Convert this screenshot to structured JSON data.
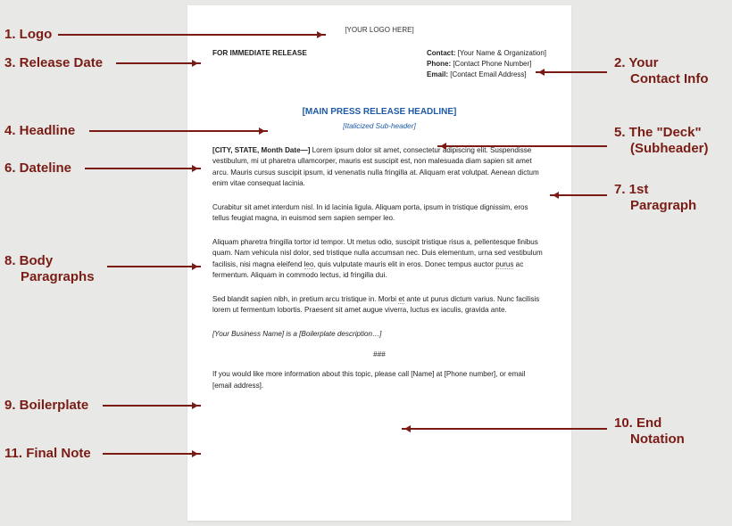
{
  "labels": {
    "l1": "1. Logo",
    "l2": "2. Your",
    "l2b": "Contact Info",
    "l3": "3. Release Date",
    "l4": "4. Headline",
    "l5": "5. The \"Deck\"",
    "l5b": "(Subheader)",
    "l6": "6. Dateline",
    "l7": "7. 1st",
    "l7b": "Paragraph",
    "l8": "8. Body",
    "l8b": "Paragraphs",
    "l9": "9. Boilerplate",
    "l10": "10. End",
    "l10b": "Notation",
    "l11": "11. Final Note"
  },
  "doc": {
    "logo": "[YOUR LOGO HERE]",
    "release": "FOR IMMEDIATE RELEASE",
    "contact": {
      "label": "Contact:",
      "val": " [Your Name & Organization]",
      "phone_label": "Phone:",
      "phone_val": " [Contact Phone Number]",
      "email_label": "Email:",
      "email_val": " [Contact Email Address]"
    },
    "headline": "[MAIN PRESS RELEASE HEADLINE]",
    "subheader": "[Italicized Sub-header]",
    "dateline": "[CITY, STATE, Month Date—]",
    "p1_rest": " Lorem ipsum dolor sit amet, consectetur adipiscing elit. Suspendisse vestibulum, mi ut pharetra ullamcorper, mauris est suscipit est, non malesuada diam sapien sit amet arcu. Mauris cursus suscipit ipsum, id venenatis nulla fringilla at. Aliquam erat volutpat. Aenean dictum enim vitae consequat lacinia.",
    "p2": "Curabitur sit amet interdum nisl. In id lacinia ligula. Aliquam porta, ipsum in tristique dignissim, eros tellus feugiat magna, in euismod sem sapien semper leo.",
    "p3a": "Aliquam pharetra fringilla tortor id tempor. Ut metus odio, suscipit tristique risus a, pellentesque finibus quam. Nam vehicula nisl dolor, sed tristique nulla accumsan nec. Duis elementum, urna sed vestibulum facilisis, nisi magna eleifend ",
    "p3b": "leo",
    "p3c": ", quis vulputate mauris elit in eros. Donec tempus auctor ",
    "p3d": "purus",
    "p3e": " ac fermentum. Aliquam in commodo lectus, id fringilla dui.",
    "p4a": "Sed blandit sapien nibh, in pretium arcu tristique in. Morbi ",
    "p4b": "et",
    "p4c": " ante ut purus dictum varius. Nunc facilisis lorem ut fermentum lobortis. Praesent sit amet augue viverra, luctus ex iaculis, gravida ante.",
    "boiler": "[Your Business Name] is a [Boilerplate description…]",
    "end": "###",
    "final": "If you would like more information about this topic, please call [Name] at [Phone number], or email [email address]."
  }
}
